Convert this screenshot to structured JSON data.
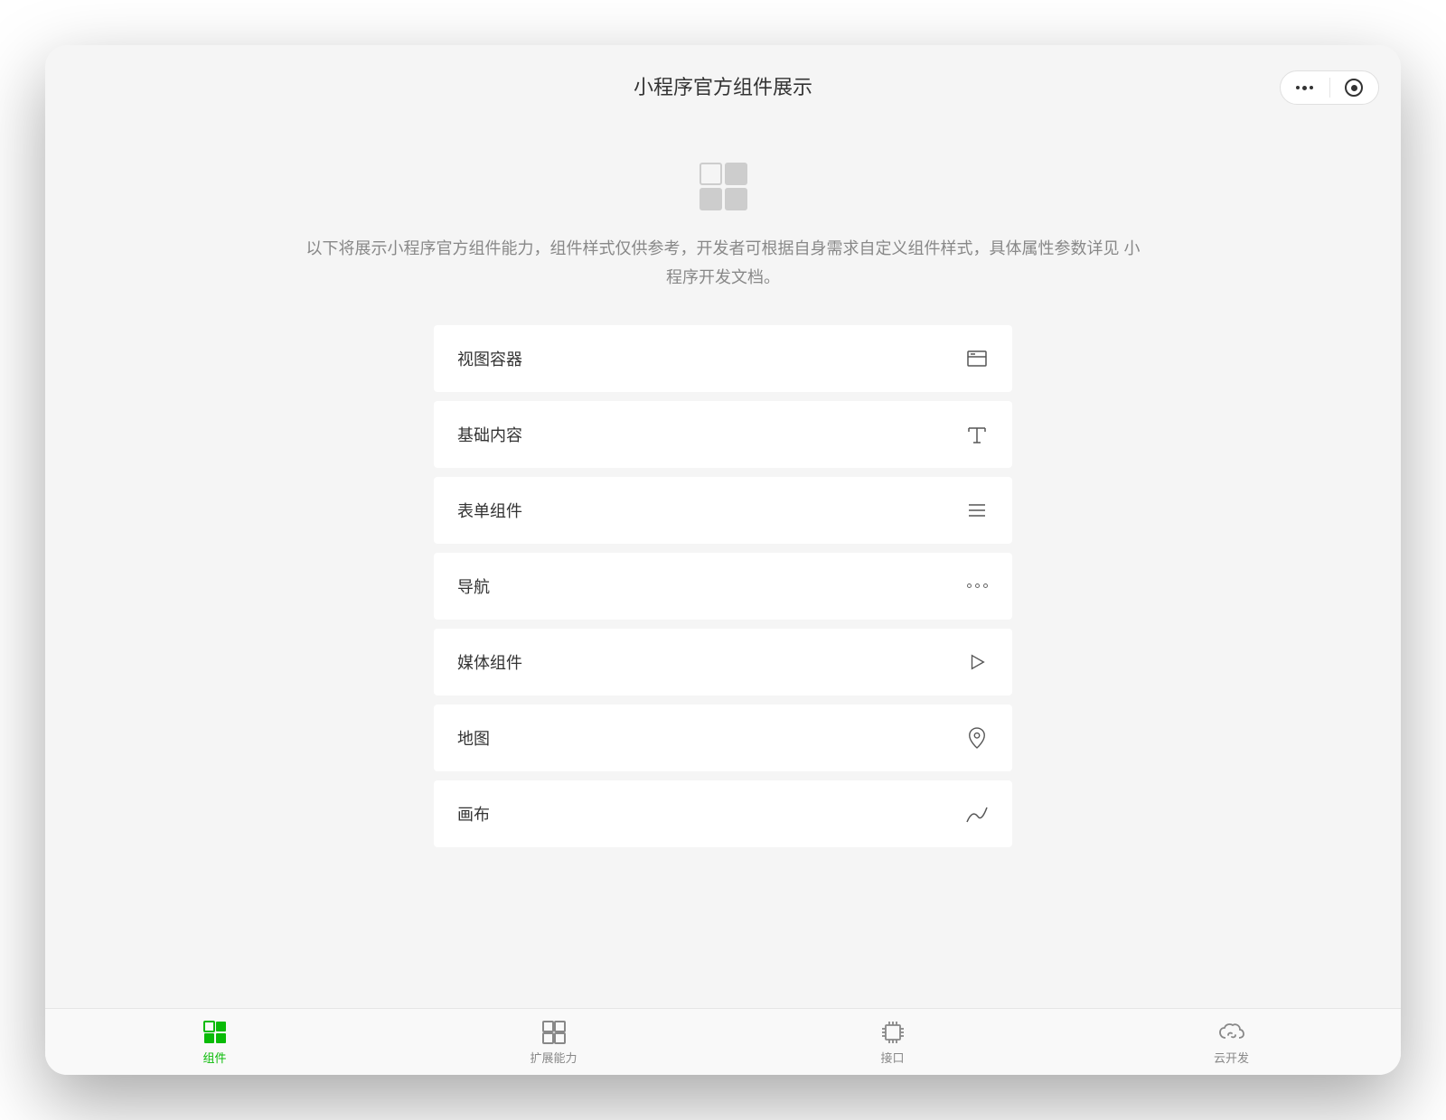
{
  "header": {
    "title": "小程序官方组件展示"
  },
  "description": {
    "text_part1": "以下将展示小程序官方组件能力，组件样式仅供参考，开发者可根据自身需求自定义组件样式，具体属性参数详见 ",
    "link_text": "小程序开发文档",
    "text_part2": "。"
  },
  "list": {
    "items": [
      {
        "label": "视图容器",
        "icon": "view-container"
      },
      {
        "label": "基础内容",
        "icon": "text"
      },
      {
        "label": "表单组件",
        "icon": "form"
      },
      {
        "label": "导航",
        "icon": "nav"
      },
      {
        "label": "媒体组件",
        "icon": "media"
      },
      {
        "label": "地图",
        "icon": "map"
      },
      {
        "label": "画布",
        "icon": "canvas"
      }
    ]
  },
  "tabbar": {
    "items": [
      {
        "label": "组件",
        "icon": "components",
        "active": true
      },
      {
        "label": "扩展能力",
        "icon": "extensions",
        "active": false
      },
      {
        "label": "接口",
        "icon": "api",
        "active": false
      },
      {
        "label": "云开发",
        "icon": "cloud",
        "active": false
      }
    ]
  },
  "colors": {
    "accent": "#09bb07"
  }
}
